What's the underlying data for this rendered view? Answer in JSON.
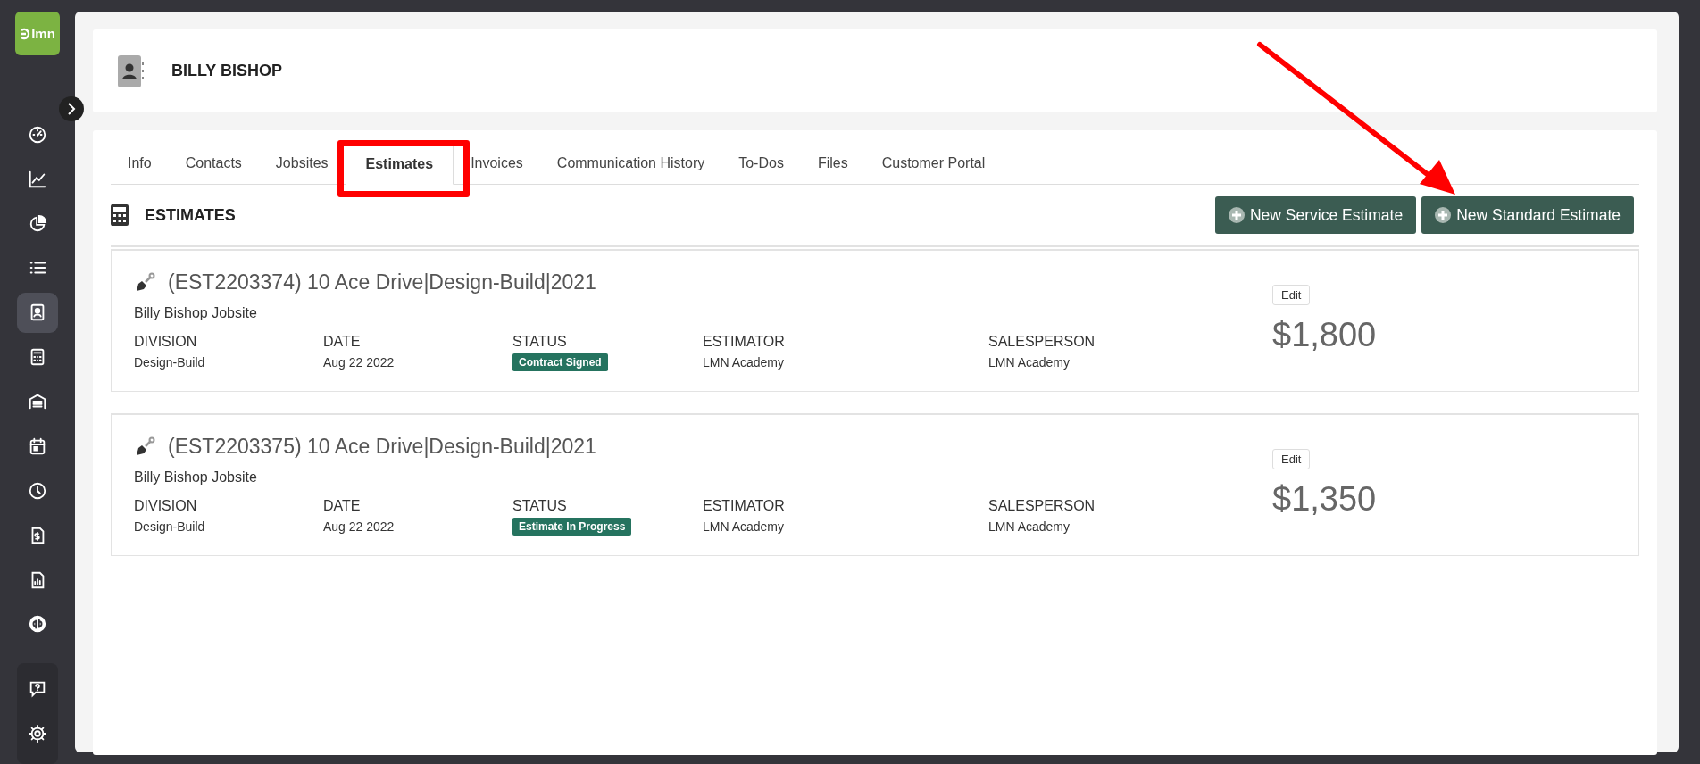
{
  "sidebar": {
    "logo": "lmn",
    "items": [
      {
        "kind": "gauge",
        "selected": false
      },
      {
        "kind": "chart",
        "selected": false
      },
      {
        "kind": "pie",
        "selected": false
      },
      {
        "kind": "list",
        "selected": false
      },
      {
        "kind": "contact",
        "selected": true
      },
      {
        "kind": "calculator",
        "selected": false
      },
      {
        "kind": "garage",
        "selected": false
      },
      {
        "kind": "calendar",
        "selected": false
      },
      {
        "kind": "clock",
        "selected": false
      },
      {
        "kind": "invoice",
        "selected": false
      },
      {
        "kind": "report",
        "selected": false
      },
      {
        "kind": "qb",
        "selected": false
      }
    ],
    "bottom_items": [
      {
        "kind": "help",
        "selected": false
      },
      {
        "kind": "settings",
        "selected": false
      }
    ]
  },
  "header": {
    "title": "BILLY BISHOP"
  },
  "tabs": [
    {
      "label": "Info",
      "selected": false
    },
    {
      "label": "Contacts",
      "selected": false
    },
    {
      "label": "Jobsites",
      "selected": false
    },
    {
      "label": "Estimates",
      "selected": true
    },
    {
      "label": "Invoices",
      "selected": false
    },
    {
      "label": "Communication History",
      "selected": false
    },
    {
      "label": "To-Dos",
      "selected": false
    },
    {
      "label": "Files",
      "selected": false
    },
    {
      "label": "Customer Portal",
      "selected": false
    }
  ],
  "section": {
    "title": "ESTIMATES",
    "buttons": [
      "New Service Estimate",
      "New Standard Estimate"
    ]
  },
  "estimates": [
    {
      "title": "(EST2203374) 10 Ace Drive|Design-Build|2021",
      "jobsite": "Billy Bishop Jobsite",
      "fields": [
        {
          "label": "DIVISION",
          "value": "Design-Build",
          "kind": "text"
        },
        {
          "label": "DATE",
          "value": "Aug 22 2022",
          "kind": "text"
        },
        {
          "label": "STATUS",
          "value": "Contract Signed",
          "kind": "badge"
        },
        {
          "label": "ESTIMATOR",
          "value": "LMN Academy",
          "kind": "text"
        },
        {
          "label": "SALESPERSON",
          "value": "LMN Academy",
          "kind": "text"
        }
      ],
      "edit": "Edit",
      "amount": "$1,800"
    },
    {
      "title": "(EST2203375) 10 Ace Drive|Design-Build|2021",
      "jobsite": "Billy Bishop Jobsite",
      "fields": [
        {
          "label": "DIVISION",
          "value": "Design-Build",
          "kind": "text"
        },
        {
          "label": "DATE",
          "value": "Aug 22 2022",
          "kind": "text"
        },
        {
          "label": "STATUS",
          "value": "Estimate In Progress",
          "kind": "badge"
        },
        {
          "label": "ESTIMATOR",
          "value": "LMN Academy",
          "kind": "text"
        },
        {
          "label": "SALESPERSON",
          "value": "LMN Academy",
          "kind": "text"
        }
      ],
      "edit": "Edit",
      "amount": "$1,350"
    }
  ]
}
